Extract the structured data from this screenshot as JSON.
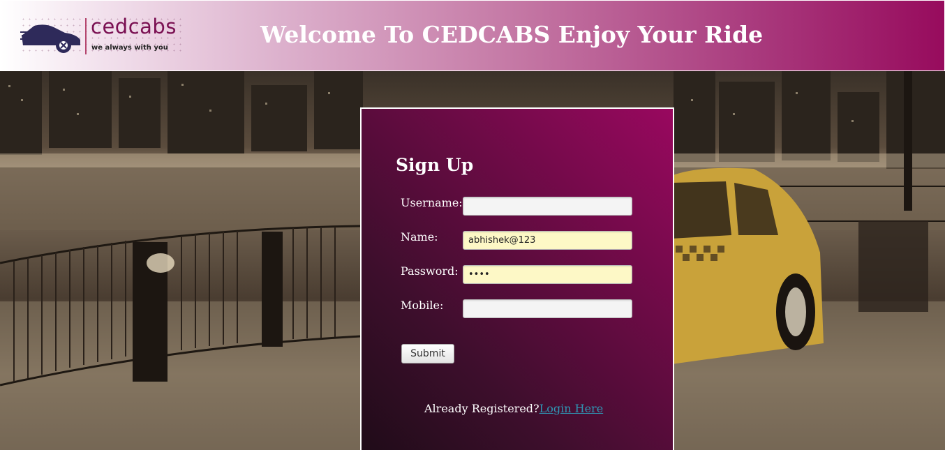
{
  "header": {
    "logo": {
      "name": "cedcabs",
      "tagline": "we always with you",
      "icon": "taxi-car-icon"
    },
    "welcome_text": "Welcome To CEDCABS Enjoy Your Ride"
  },
  "background": {
    "description": "night city waterfront with yellow taxi"
  },
  "signup_form": {
    "title": "Sign Up",
    "fields": [
      {
        "label": "Username:",
        "value": "",
        "type": "text"
      },
      {
        "label": "Name:",
        "value": "abhishek@123",
        "type": "text"
      },
      {
        "label": "Password:",
        "value": "••••",
        "type": "password"
      },
      {
        "label": "Mobile:",
        "value": "",
        "type": "text"
      }
    ],
    "submit_label": "Submit",
    "already_registered_text": "Already Registered?",
    "login_link_text": "Login Here"
  },
  "colors": {
    "header_gradient_end": "#970b5d",
    "panel_top": "#99085f",
    "panel_bottom": "#1f0c18",
    "link": "#2f96b4",
    "autofill": "#fdf8c6",
    "taxi_yellow": "#c9a23a"
  }
}
